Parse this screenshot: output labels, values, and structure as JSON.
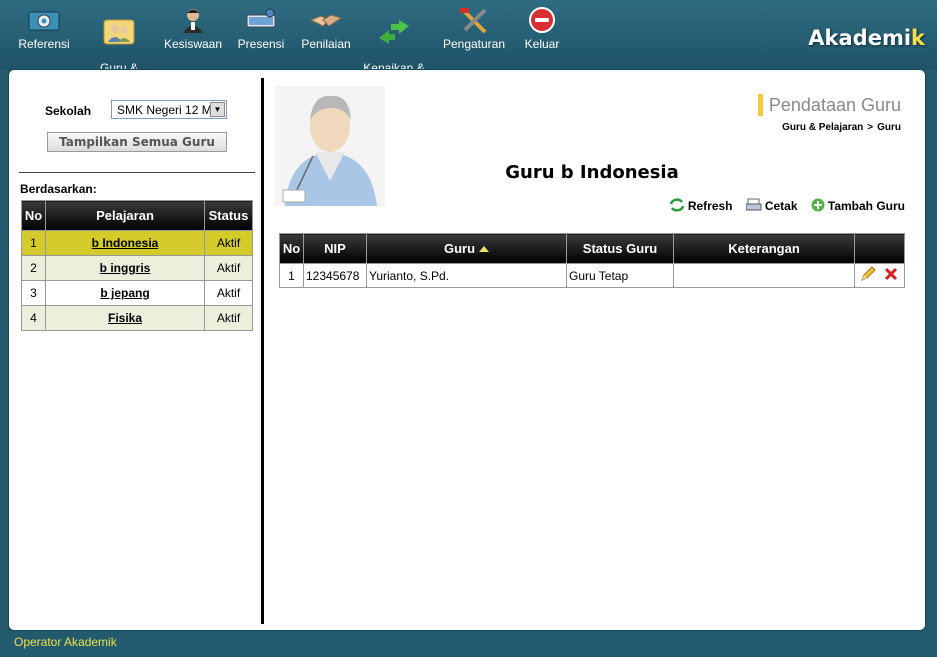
{
  "app": {
    "brand_main": "Akademi",
    "brand_last": "k"
  },
  "nav": [
    {
      "label": "Referensi",
      "icon": "gear-icon"
    },
    {
      "label": "Guru &\nPelajaran",
      "icon": "teachers-icon"
    },
    {
      "label": "Kesiswaan",
      "icon": "student-icon"
    },
    {
      "label": "Presensi",
      "icon": "attendance-icon"
    },
    {
      "label": "Penilaian",
      "icon": "handshake-icon"
    },
    {
      "label": "Kenaikan &\nKelulusan",
      "icon": "promotion-arrows-icon"
    },
    {
      "label": "Pengaturan",
      "icon": "tools-icon"
    },
    {
      "label": "Keluar",
      "icon": "power-icon"
    }
  ],
  "sidebar": {
    "sekolah_label": "Sekolah",
    "sekolah_value": "SMK Negeri 12 M",
    "show_all_label": "Tampilkan Semua Guru",
    "berdasarkan_label": "Berdasarkan:",
    "table_headers": [
      "No",
      "Pelajaran",
      "Status"
    ],
    "rows": [
      {
        "no": "1",
        "subject": "b Indonesia",
        "status": "Aktif"
      },
      {
        "no": "2",
        "subject": "b inggris",
        "status": "Aktif"
      },
      {
        "no": "3",
        "subject": "b jepang",
        "status": "Aktif"
      },
      {
        "no": "4",
        "subject": "Fisika",
        "status": "Aktif"
      }
    ]
  },
  "main": {
    "page_title": "Pendataan Guru",
    "breadcrumb": [
      "Guru & Pelajaran",
      ">",
      "Guru"
    ],
    "heading": "Guru b Indonesia",
    "actions": {
      "refresh": "Refresh",
      "print": "Cetak",
      "add": "Tambah Guru"
    },
    "table_headers": [
      "No",
      "NIP",
      "Guru",
      "Status Guru",
      "Keterangan",
      ""
    ],
    "rows": [
      {
        "no": "1",
        "nip": "12345678",
        "guru": "Yurianto, S.Pd.",
        "status": "Guru Tetap",
        "keterangan": ""
      }
    ]
  },
  "footer": {
    "text": "Operator Akademik"
  },
  "colors": {
    "header_bg": "#2a6478",
    "selected_row": "#d3cb2a",
    "accent": "#f3cb3f"
  }
}
